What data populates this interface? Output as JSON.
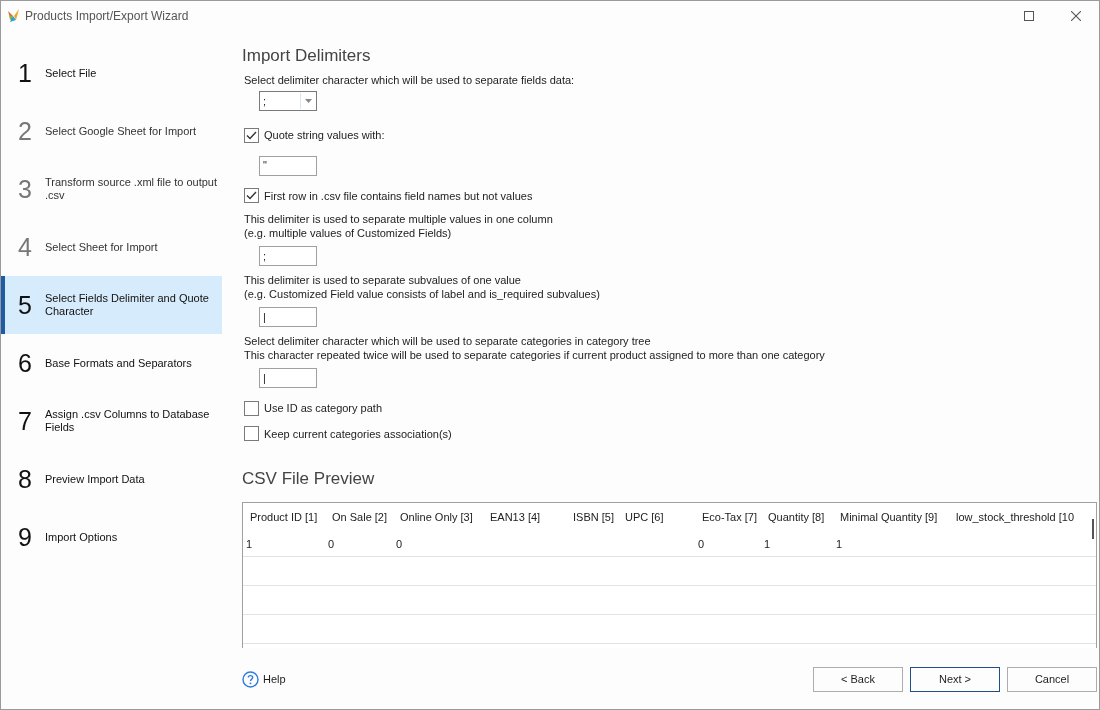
{
  "window": {
    "title": "Products Import/Export Wizard"
  },
  "steps": [
    {
      "number": "1",
      "label": "Select File",
      "selected": false,
      "disabled": false
    },
    {
      "number": "2",
      "label": "Select Google Sheet for Import",
      "selected": false,
      "disabled": true
    },
    {
      "number": "3",
      "label": "Transform source .xml file to output .csv",
      "selected": false,
      "disabled": true
    },
    {
      "number": "4",
      "label": "Select Sheet for Import",
      "selected": false,
      "disabled": true
    },
    {
      "number": "5",
      "label": "Select Fields Delimiter and Quote Character",
      "selected": true,
      "disabled": false
    },
    {
      "number": "6",
      "label": "Base Formats and Separators",
      "selected": false,
      "disabled": false
    },
    {
      "number": "7",
      "label": "Assign .csv Columns to Database Fields",
      "selected": false,
      "disabled": false
    },
    {
      "number": "8",
      "label": "Preview Import Data",
      "selected": false,
      "disabled": false
    },
    {
      "number": "9",
      "label": "Import Options",
      "selected": false,
      "disabled": false
    }
  ],
  "delimiters": {
    "heading": "Import Delimiters",
    "items": [
      {
        "kind": "label",
        "text": "Select delimiter character which will be used to separate fields data:"
      },
      {
        "kind": "combo",
        "value": ";"
      },
      {
        "kind": "checkbox",
        "label": "Quote string values with:",
        "checked": true
      },
      {
        "kind": "input",
        "value": "\""
      },
      {
        "kind": "checkbox",
        "label": "First row in .csv file contains field names but not values",
        "checked": true
      },
      {
        "kind": "label",
        "text": "This delimiter is used to separate multiple values in one column\n(e.g. multiple values of Customized Fields)"
      },
      {
        "kind": "input",
        "value": ";"
      },
      {
        "kind": "label",
        "text": "This delimiter is used to separate subvalues of one value\n(e.g. Customized Field value consists of label and is_required subvalues)"
      },
      {
        "kind": "input",
        "value": "|"
      },
      {
        "kind": "label",
        "text": "Select delimiter character which will be used to separate categories in category tree\nThis character repeated twice will be used to separate categories if current product assigned to more than one category"
      },
      {
        "kind": "input",
        "value": "|"
      },
      {
        "kind": "checkbox",
        "label": "Use ID as category path",
        "checked": false
      },
      {
        "kind": "checkbox",
        "label": "Keep current categories association(s)",
        "checked": false
      }
    ]
  },
  "preview": {
    "heading": "CSV File Preview",
    "columns": [
      "Product ID [1]",
      "On Sale [2]",
      "Online Only [3]",
      "EAN13 [4]",
      "ISBN [5]",
      "UPC [6]",
      "Eco-Tax [7]",
      "Quantity [8]",
      "Minimal Quantity [9]",
      "low_stock_threshold [10"
    ],
    "rows": [
      {
        "cells": [
          "1",
          "0",
          "0",
          null,
          null,
          null,
          "0",
          "1",
          "1",
          null
        ]
      }
    ]
  },
  "footer": {
    "help": "Help",
    "buttons": [
      {
        "label": "< Back",
        "default": false
      },
      {
        "label": "Next >",
        "default": true
      },
      {
        "label": "Cancel",
        "default": false
      }
    ]
  }
}
